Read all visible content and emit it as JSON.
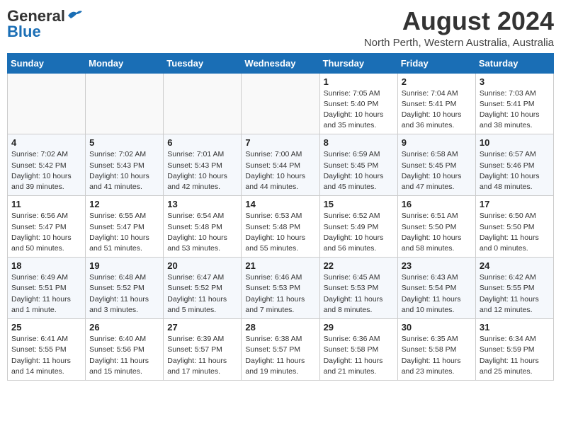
{
  "header": {
    "logo_general": "General",
    "logo_blue": "Blue",
    "month_title": "August 2024",
    "location": "North Perth, Western Australia, Australia"
  },
  "weekdays": [
    "Sunday",
    "Monday",
    "Tuesday",
    "Wednesday",
    "Thursday",
    "Friday",
    "Saturday"
  ],
  "weeks": [
    [
      {
        "day": "",
        "info": ""
      },
      {
        "day": "",
        "info": ""
      },
      {
        "day": "",
        "info": ""
      },
      {
        "day": "",
        "info": ""
      },
      {
        "day": "1",
        "info": "Sunrise: 7:05 AM\nSunset: 5:40 PM\nDaylight: 10 hours\nand 35 minutes."
      },
      {
        "day": "2",
        "info": "Sunrise: 7:04 AM\nSunset: 5:41 PM\nDaylight: 10 hours\nand 36 minutes."
      },
      {
        "day": "3",
        "info": "Sunrise: 7:03 AM\nSunset: 5:41 PM\nDaylight: 10 hours\nand 38 minutes."
      }
    ],
    [
      {
        "day": "4",
        "info": "Sunrise: 7:02 AM\nSunset: 5:42 PM\nDaylight: 10 hours\nand 39 minutes."
      },
      {
        "day": "5",
        "info": "Sunrise: 7:02 AM\nSunset: 5:43 PM\nDaylight: 10 hours\nand 41 minutes."
      },
      {
        "day": "6",
        "info": "Sunrise: 7:01 AM\nSunset: 5:43 PM\nDaylight: 10 hours\nand 42 minutes."
      },
      {
        "day": "7",
        "info": "Sunrise: 7:00 AM\nSunset: 5:44 PM\nDaylight: 10 hours\nand 44 minutes."
      },
      {
        "day": "8",
        "info": "Sunrise: 6:59 AM\nSunset: 5:45 PM\nDaylight: 10 hours\nand 45 minutes."
      },
      {
        "day": "9",
        "info": "Sunrise: 6:58 AM\nSunset: 5:45 PM\nDaylight: 10 hours\nand 47 minutes."
      },
      {
        "day": "10",
        "info": "Sunrise: 6:57 AM\nSunset: 5:46 PM\nDaylight: 10 hours\nand 48 minutes."
      }
    ],
    [
      {
        "day": "11",
        "info": "Sunrise: 6:56 AM\nSunset: 5:47 PM\nDaylight: 10 hours\nand 50 minutes."
      },
      {
        "day": "12",
        "info": "Sunrise: 6:55 AM\nSunset: 5:47 PM\nDaylight: 10 hours\nand 51 minutes."
      },
      {
        "day": "13",
        "info": "Sunrise: 6:54 AM\nSunset: 5:48 PM\nDaylight: 10 hours\nand 53 minutes."
      },
      {
        "day": "14",
        "info": "Sunrise: 6:53 AM\nSunset: 5:48 PM\nDaylight: 10 hours\nand 55 minutes."
      },
      {
        "day": "15",
        "info": "Sunrise: 6:52 AM\nSunset: 5:49 PM\nDaylight: 10 hours\nand 56 minutes."
      },
      {
        "day": "16",
        "info": "Sunrise: 6:51 AM\nSunset: 5:50 PM\nDaylight: 10 hours\nand 58 minutes."
      },
      {
        "day": "17",
        "info": "Sunrise: 6:50 AM\nSunset: 5:50 PM\nDaylight: 11 hours\nand 0 minutes."
      }
    ],
    [
      {
        "day": "18",
        "info": "Sunrise: 6:49 AM\nSunset: 5:51 PM\nDaylight: 11 hours\nand 1 minute."
      },
      {
        "day": "19",
        "info": "Sunrise: 6:48 AM\nSunset: 5:52 PM\nDaylight: 11 hours\nand 3 minutes."
      },
      {
        "day": "20",
        "info": "Sunrise: 6:47 AM\nSunset: 5:52 PM\nDaylight: 11 hours\nand 5 minutes."
      },
      {
        "day": "21",
        "info": "Sunrise: 6:46 AM\nSunset: 5:53 PM\nDaylight: 11 hours\nand 7 minutes."
      },
      {
        "day": "22",
        "info": "Sunrise: 6:45 AM\nSunset: 5:53 PM\nDaylight: 11 hours\nand 8 minutes."
      },
      {
        "day": "23",
        "info": "Sunrise: 6:43 AM\nSunset: 5:54 PM\nDaylight: 11 hours\nand 10 minutes."
      },
      {
        "day": "24",
        "info": "Sunrise: 6:42 AM\nSunset: 5:55 PM\nDaylight: 11 hours\nand 12 minutes."
      }
    ],
    [
      {
        "day": "25",
        "info": "Sunrise: 6:41 AM\nSunset: 5:55 PM\nDaylight: 11 hours\nand 14 minutes."
      },
      {
        "day": "26",
        "info": "Sunrise: 6:40 AM\nSunset: 5:56 PM\nDaylight: 11 hours\nand 15 minutes."
      },
      {
        "day": "27",
        "info": "Sunrise: 6:39 AM\nSunset: 5:57 PM\nDaylight: 11 hours\nand 17 minutes."
      },
      {
        "day": "28",
        "info": "Sunrise: 6:38 AM\nSunset: 5:57 PM\nDaylight: 11 hours\nand 19 minutes."
      },
      {
        "day": "29",
        "info": "Sunrise: 6:36 AM\nSunset: 5:58 PM\nDaylight: 11 hours\nand 21 minutes."
      },
      {
        "day": "30",
        "info": "Sunrise: 6:35 AM\nSunset: 5:58 PM\nDaylight: 11 hours\nand 23 minutes."
      },
      {
        "day": "31",
        "info": "Sunrise: 6:34 AM\nSunset: 5:59 PM\nDaylight: 11 hours\nand 25 minutes."
      }
    ]
  ],
  "colors": {
    "header_bg": "#1a6eb5",
    "logo_blue": "#1a6eb5"
  }
}
